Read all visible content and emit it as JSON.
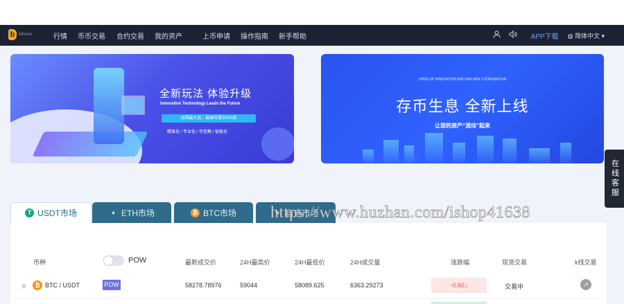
{
  "nav": {
    "logo_text": "bitlume",
    "items": [
      "行情",
      "币币交易",
      "合约交易",
      "我的资产",
      "上币申请",
      "操作指南",
      "新手帮助"
    ],
    "app_download": "APP下载",
    "language": "简体中文"
  },
  "banners": [
    {
      "title": "全新玩法 体验升级",
      "subtitle": "Innovation Technology Leads the Future",
      "pill": "充得最大奖，最高可拿20%9奖",
      "tags": "精准化  /  专业化  /  可信赖  /  智能化"
    },
    {
      "top": "OPEN UP INNOVATION AND WIN-WIN COOPERATION",
      "title": "存币生息 全新上线",
      "subtitle": "让您的资产“流动”起来"
    }
  ],
  "customer_service": "在线客服",
  "tabs": [
    {
      "label": "USDT市场",
      "icon": "T"
    },
    {
      "label": "ETH市场",
      "icon": "♦"
    },
    {
      "label": "BTC市场",
      "icon": "₿"
    },
    {
      "label": "自选市场",
      "icon": "★"
    }
  ],
  "table": {
    "headers": [
      "币种",
      "最新成交价",
      "24H最高价",
      "24H最低价",
      "24H成交量",
      "涨跌幅",
      "现货交易",
      "k线交易"
    ],
    "pow_toggle_label": "POW",
    "rows": [
      {
        "pair": "BTC / USDT",
        "tag": "POW",
        "last_price": "58278.78976",
        "high": "59044",
        "low": "58089.625",
        "volume": "6363.29273",
        "change": "-0.66↓",
        "trade": "交易中"
      }
    ]
  },
  "watermark": "https://www.huzhan.com/ishop41638",
  "colors": {
    "navbar": "#1c2232",
    "tab_active_text": "#1a6e8e",
    "tab_inactive_bg": "#2f6b8a",
    "change_down": "#e8514a",
    "app_link": "#6aa0ff"
  }
}
